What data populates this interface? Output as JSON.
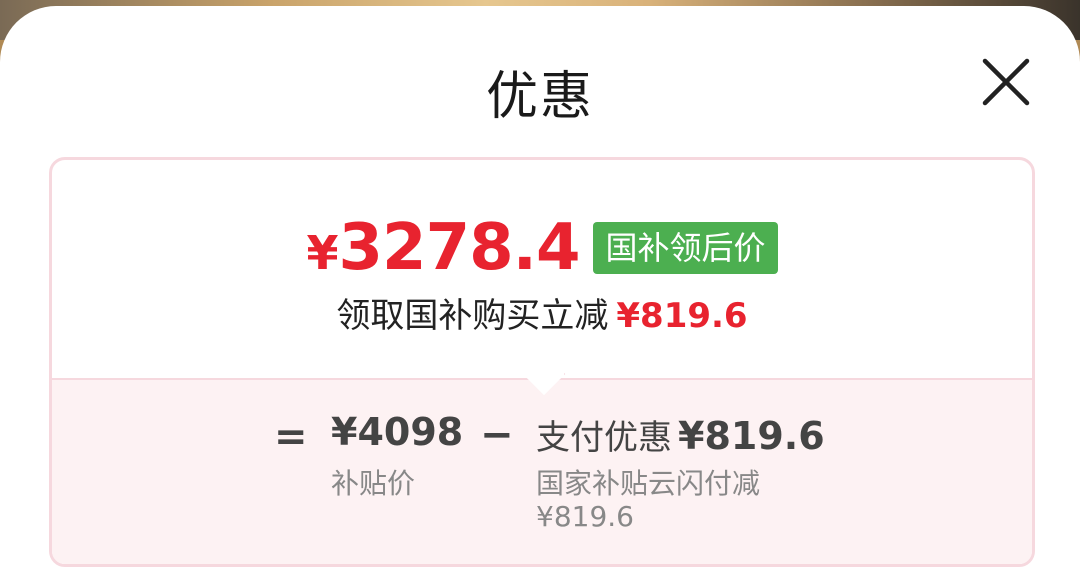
{
  "header": {
    "title": "优惠",
    "close_icon": "close-icon"
  },
  "price_card": {
    "final_price_currency": "¥",
    "final_price_value": "3278.4",
    "final_price_tag": "国补领后价",
    "discount_text": "领取国补购买立减",
    "discount_amount": "¥819.6"
  },
  "formula": {
    "equals_sign": "=",
    "base_price": "¥4098",
    "base_price_label": "补贴价",
    "minus_sign": "−",
    "payment_label": "支付优惠",
    "payment_amount": "¥819.6",
    "payment_desc": "国家补贴云闪付减",
    "payment_desc_amount": "¥819.6"
  },
  "colors": {
    "accent_red": "#e8232f",
    "tag_green": "#4caf50",
    "card_border": "#f6d8de",
    "card_bottom_bg": "#fdf2f3"
  }
}
